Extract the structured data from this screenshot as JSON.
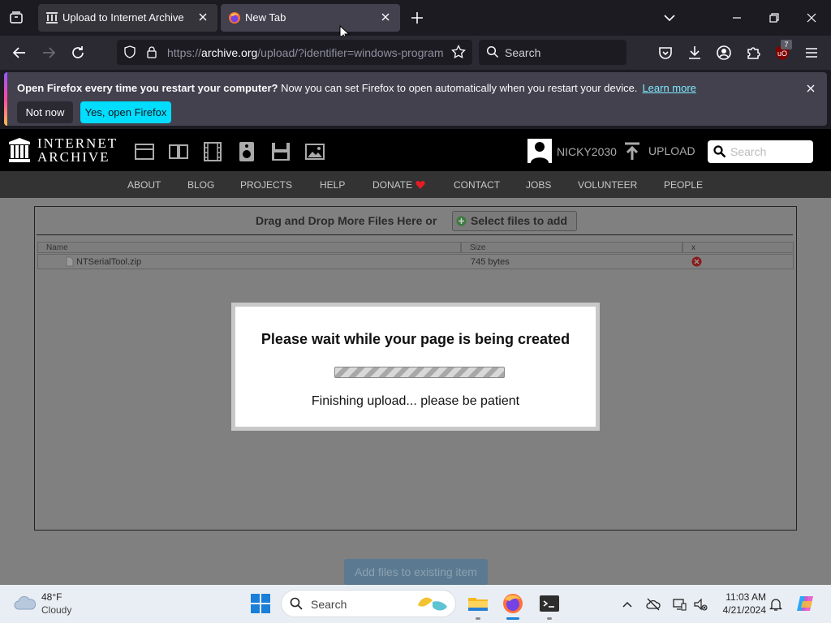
{
  "browser": {
    "tabs": [
      {
        "title": "Upload to Internet Archive",
        "active": false
      },
      {
        "title": "New Tab",
        "active": true
      }
    ],
    "url": {
      "prefix": "https://",
      "host": "archive.org",
      "path": "/upload/?identifier=windows-program"
    },
    "search_placeholder": "Search",
    "extension_badge": "7"
  },
  "notification": {
    "bold": "Open Firefox every time you restart your computer?",
    "text": " Now you can set Firefox to open automatically when you restart your device.",
    "link": "Learn more",
    "not_now": "Not now",
    "yes": "Yes, open Firefox"
  },
  "site": {
    "logo_line1": "INTERNET",
    "logo_line2": "ARCHIVE",
    "username": "NICKY2030",
    "upload": "UPLOAD",
    "search_placeholder": "Search",
    "nav": [
      "ABOUT",
      "BLOG",
      "PROJECTS",
      "HELP",
      "DONATE",
      "CONTACT",
      "JOBS",
      "VOLUNTEER",
      "PEOPLE"
    ]
  },
  "upload": {
    "drop_title": "Drag and Drop More Files Here or",
    "select_button": "Select files to add",
    "columns": {
      "name": "Name",
      "size": "Size",
      "remove": "x"
    },
    "files": [
      {
        "name": "NTSerialTool.zip",
        "size": "745 bytes"
      }
    ],
    "add_existing": "Add files to existing item"
  },
  "modal": {
    "title": "Please wait while your page is being created",
    "message": "Finishing upload... please be patient"
  },
  "taskbar": {
    "weather_temp": "48°F",
    "weather_cond": "Cloudy",
    "search": "Search",
    "time": "11:03 AM",
    "date": "4/21/2024"
  },
  "colors": {
    "firefox_accent": "#00ddff",
    "remove_icon": "#cc2222",
    "donate_heart": "#e51c23"
  }
}
